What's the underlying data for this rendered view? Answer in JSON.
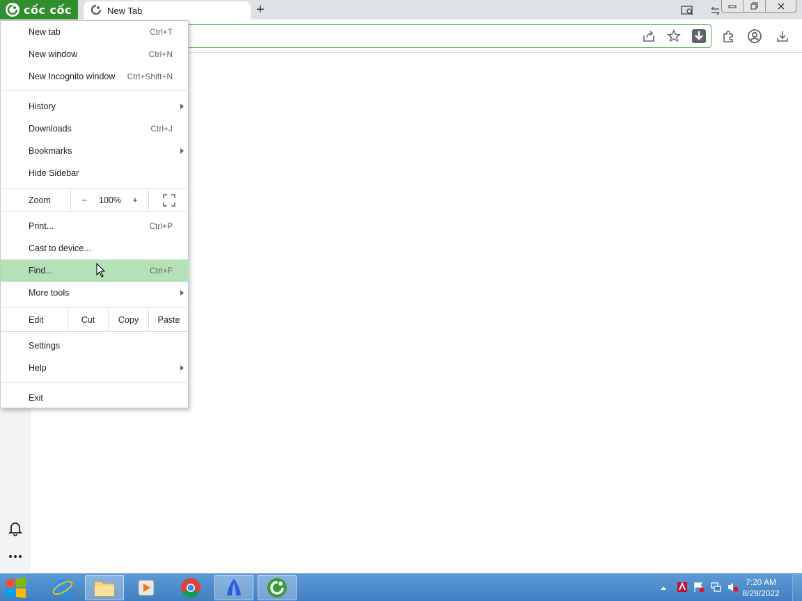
{
  "browser": {
    "brand_name": "cốc cốc",
    "active_tab_title": "New Tab",
    "new_tab_symbol": "+"
  },
  "menu": {
    "new_tab": {
      "label": "New tab",
      "shortcut": "Ctrl+T"
    },
    "new_window": {
      "label": "New window",
      "shortcut": "Ctrl+N"
    },
    "new_incognito": {
      "label": "New Incognito window",
      "shortcut": "Ctrl+Shift+N"
    },
    "history": {
      "label": "History"
    },
    "downloads": {
      "label": "Downloads",
      "shortcut": "Ctrl+J"
    },
    "bookmarks": {
      "label": "Bookmarks"
    },
    "hide_sidebar": {
      "label": "Hide Sidebar"
    },
    "zoom": {
      "label": "Zoom",
      "minus": "−",
      "value": "100%",
      "plus": "+"
    },
    "print": {
      "label": "Print...",
      "shortcut": "Ctrl+P"
    },
    "cast": {
      "label": "Cast to device..."
    },
    "find": {
      "label": "Find...",
      "shortcut": "Ctrl+F"
    },
    "more_tools": {
      "label": "More tools"
    },
    "edit": {
      "label": "Edit",
      "cut": "Cut",
      "copy": "Copy",
      "paste": "Paste"
    },
    "settings": {
      "label": "Settings"
    },
    "help": {
      "label": "Help"
    },
    "exit": {
      "label": "Exit"
    }
  },
  "taskbar": {
    "time": "7:20 AM",
    "date": "8/29/2022"
  },
  "colors": {
    "brand_green": "#2f8f2f",
    "menu_highlight": "#b5e1b9",
    "taskbar_blue": "#4a8bcb"
  }
}
